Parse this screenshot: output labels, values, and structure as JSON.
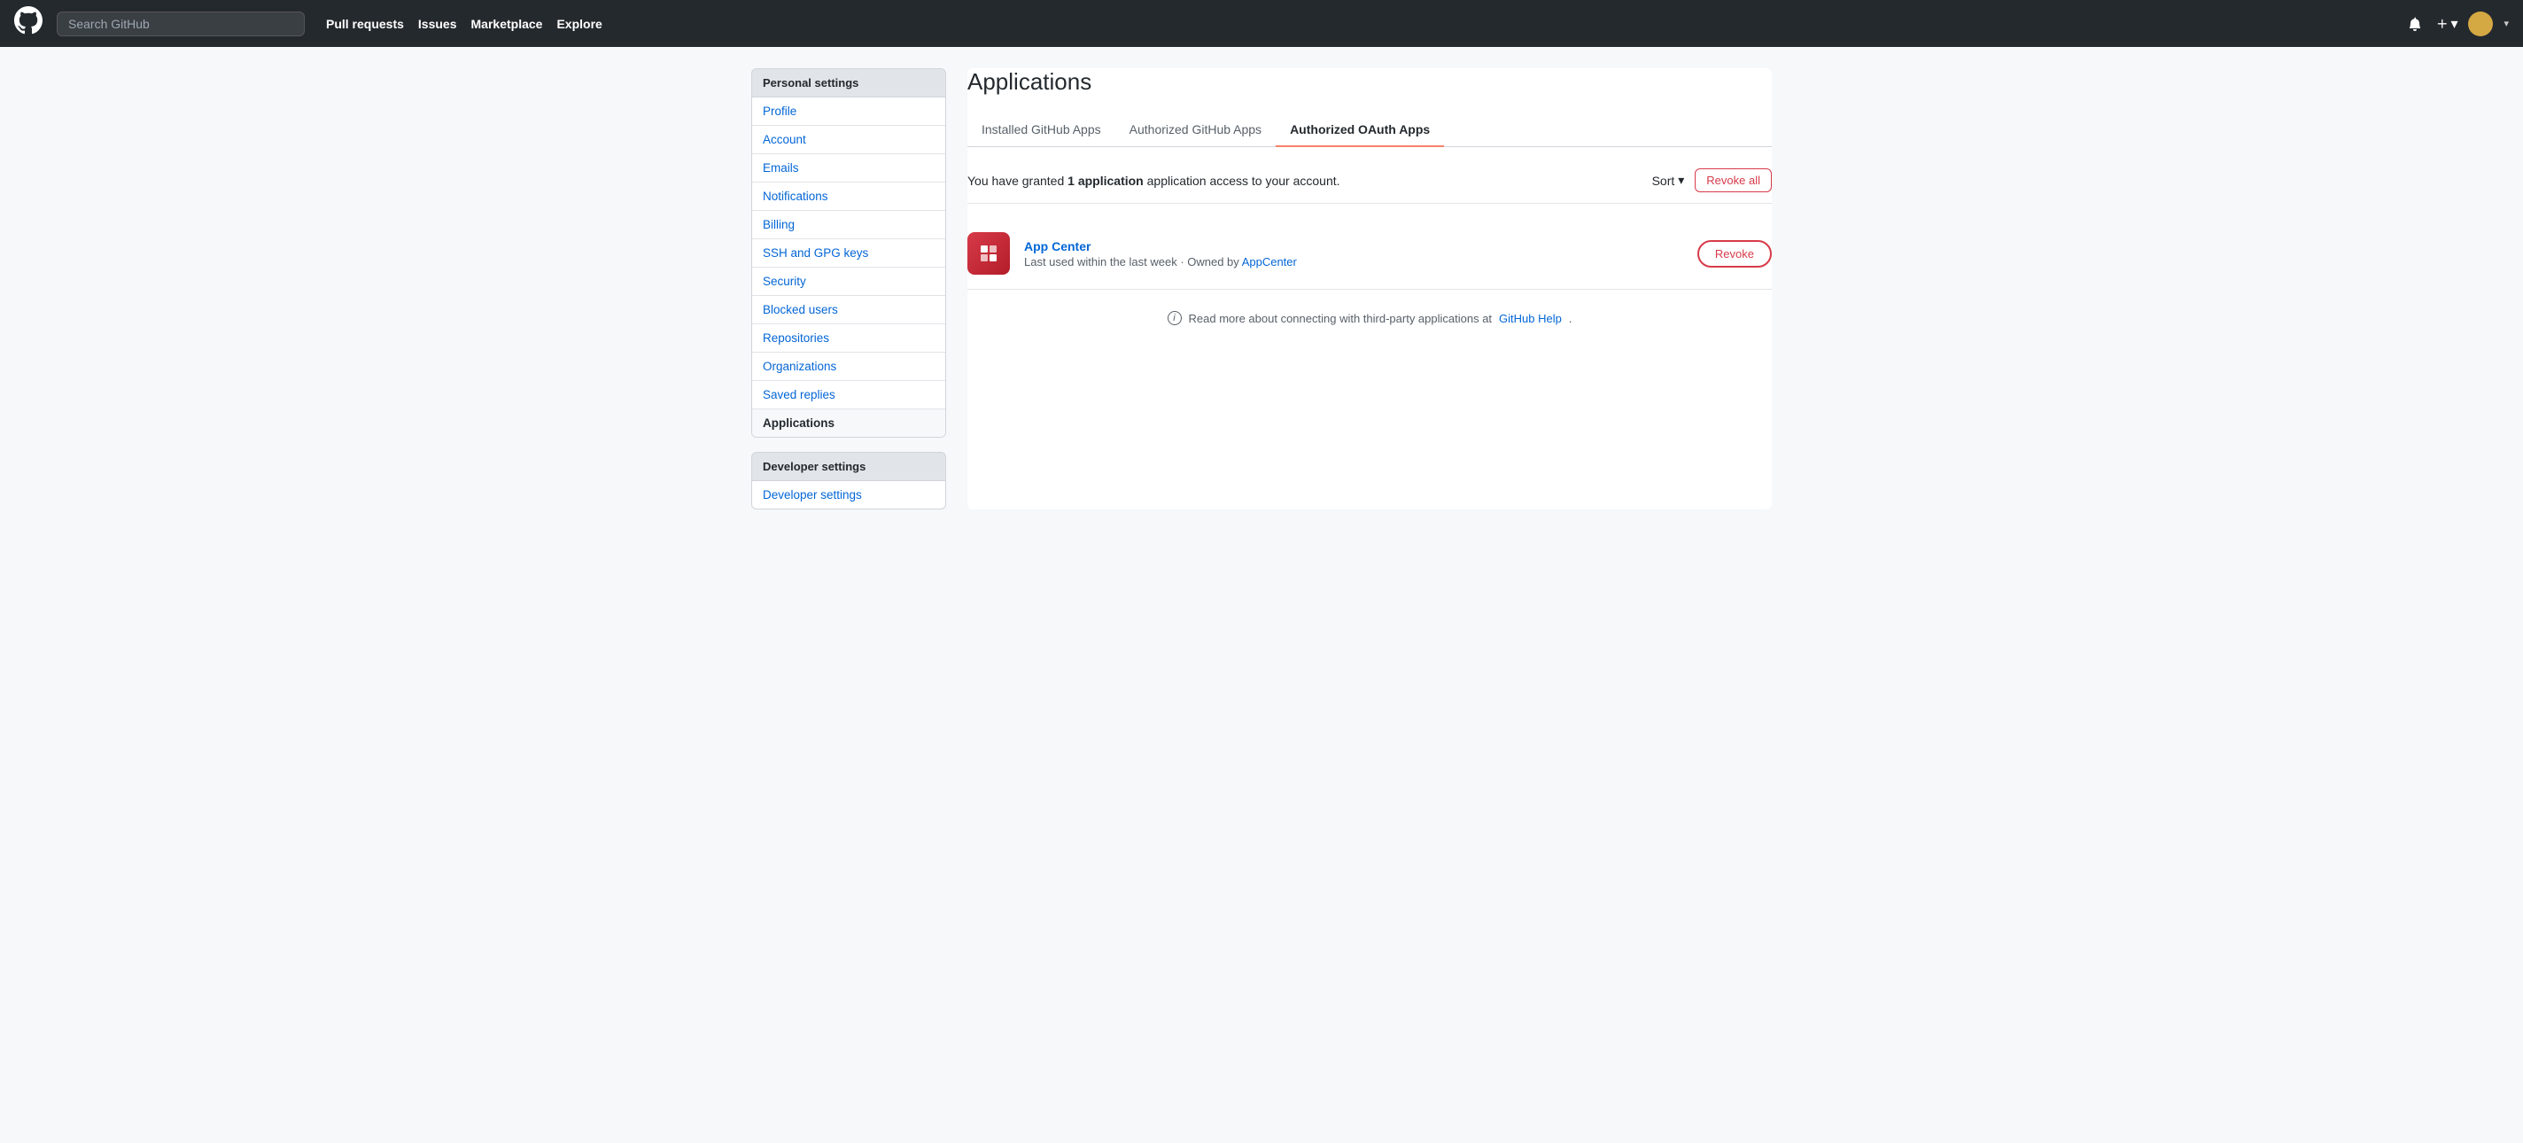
{
  "navbar": {
    "search_placeholder": "Search GitHub",
    "pull_requests": "Pull requests",
    "issues": "Issues",
    "marketplace": "Marketplace",
    "explore": "Explore"
  },
  "sidebar": {
    "section_title": "Personal settings",
    "items": [
      {
        "label": "Profile",
        "active": false
      },
      {
        "label": "Account",
        "active": false
      },
      {
        "label": "Emails",
        "active": false
      },
      {
        "label": "Notifications",
        "active": false
      },
      {
        "label": "Billing",
        "active": false
      },
      {
        "label": "SSH and GPG keys",
        "active": false
      },
      {
        "label": "Security",
        "active": false
      },
      {
        "label": "Blocked users",
        "active": false
      },
      {
        "label": "Repositories",
        "active": false
      },
      {
        "label": "Organizations",
        "active": false
      },
      {
        "label": "Saved replies",
        "active": false
      },
      {
        "label": "Applications",
        "active": true
      }
    ],
    "section2_title": "Developer settings",
    "section2_items": []
  },
  "page": {
    "title": "Applications",
    "tabs": [
      {
        "label": "Installed GitHub Apps",
        "active": false
      },
      {
        "label": "Authorized GitHub Apps",
        "active": false
      },
      {
        "label": "Authorized OAuth Apps",
        "active": true
      }
    ],
    "app_count_text_prefix": "You have granted",
    "app_count_number": "1",
    "app_count_text_suffix": "application access to your account.",
    "sort_label": "Sort",
    "revoke_all_label": "Revoke all",
    "apps": [
      {
        "name": "App Center",
        "meta": "Last used within the last week · Owned by",
        "owner": "AppCenter",
        "revoke_label": "Revoke"
      }
    ],
    "info_note_prefix": "Read more about connecting with third-party applications at",
    "info_link_label": "GitHub Help",
    "info_note_suffix": "."
  }
}
